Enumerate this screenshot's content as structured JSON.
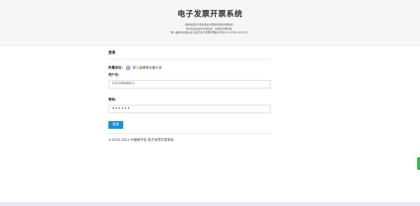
{
  "header": {
    "title": "电子发票开票系统",
    "intro_lines": [
      "请使用您的开具或参会代表账号登录开票系统。",
      "您可在此处填写开具信息，并提交开票申请。",
      "第八届蜂电仪器大会·会议的电子发票开票截止时间为 2023年10月15日。"
    ]
  },
  "login": {
    "section_title": "登录",
    "meeting_label": "所属会议:",
    "meeting_name": "第八届蜂电仪器大会",
    "username_label": "用户名:",
    "username_value": "13126698612",
    "password_label": "密码:",
    "password_value": "••••••",
    "login_button": "登录"
  },
  "footer": {
    "copyright": "©2020-2023 中国蜂学会 电子发票开票系统"
  }
}
